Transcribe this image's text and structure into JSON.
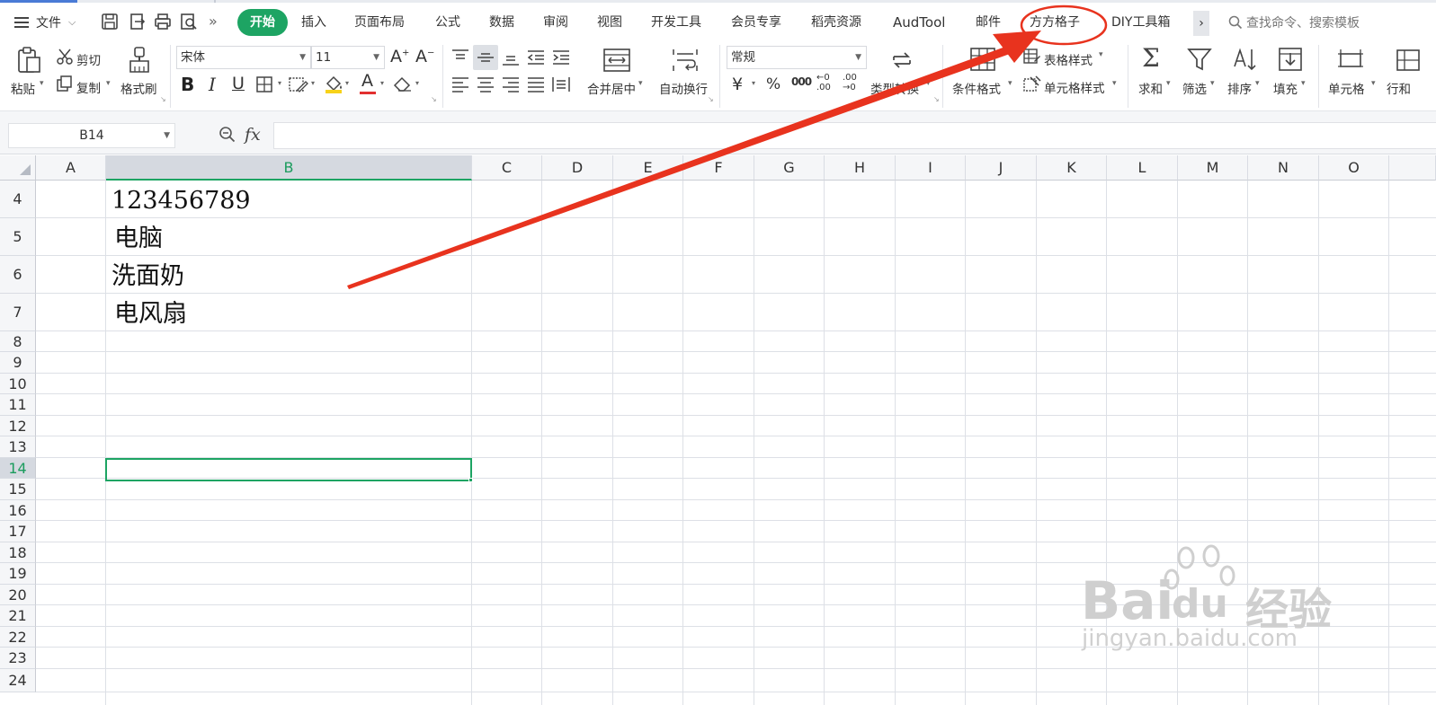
{
  "menu": {
    "file_label": "文件",
    "more_label": "»",
    "scroll_right": "›"
  },
  "tabs": [
    {
      "label": "开始",
      "active": true
    },
    {
      "label": "插入"
    },
    {
      "label": "页面布局"
    },
    {
      "label": "公式"
    },
    {
      "label": "数据"
    },
    {
      "label": "审阅"
    },
    {
      "label": "视图"
    },
    {
      "label": "开发工具"
    },
    {
      "label": "会员专享"
    },
    {
      "label": "稻壳资源"
    },
    {
      "label": "AudTool"
    },
    {
      "label": "邮件"
    },
    {
      "label": "方方格子"
    },
    {
      "label": "DIY工具箱"
    }
  ],
  "search": {
    "placeholder": "查找命令、搜索模板"
  },
  "ribbon": {
    "paste": "粘贴",
    "cut": "剪切",
    "copy": "复制",
    "format_painter": "格式刷",
    "font_name": "宋体",
    "font_size": "11",
    "merge_center": "合并居中",
    "wrap_text": "自动换行",
    "number_format": "常规",
    "currency_symbol": "¥",
    "percent_symbol": "%",
    "thousands": "000",
    "dec_increase": ".00",
    "dec_decrease": ".00",
    "type_convert": "类型转换",
    "conditional_format": "条件格式",
    "table_style": "表格样式",
    "cell_style": "单元格样式",
    "sum": "求和",
    "filter": "筛选",
    "sort": "排序",
    "fill": "填充",
    "cell": "单元格",
    "row_col": "行和"
  },
  "formula_bar": {
    "name_box": "B14",
    "fx": "fx",
    "value": ""
  },
  "sheet": {
    "columns": [
      "A",
      "B",
      "C",
      "D",
      "E",
      "F",
      "G",
      "H",
      "I",
      "J",
      "K",
      "L",
      "M",
      "N",
      "O"
    ],
    "selected_column": "B",
    "rows": [
      "4",
      "5",
      "6",
      "7",
      "8",
      "9",
      "10",
      "11",
      "12",
      "13",
      "14",
      "15",
      "16",
      "17",
      "18",
      "19",
      "20",
      "21",
      "22",
      "23",
      "24"
    ],
    "selected_row": "14",
    "cells": [
      {
        "ref": "B4",
        "value": "123456789"
      },
      {
        "ref": "B5",
        "value": "电脑"
      },
      {
        "ref": "B6",
        "value": "洗面奶"
      },
      {
        "ref": "B7",
        "value": "电风扇"
      }
    ]
  },
  "watermark": {
    "brand": "Bai",
    "paw": "du",
    "jy": "经验",
    "url": "jingyan.baidu.com"
  },
  "annotation": {
    "color": "#e8331e",
    "target_tab": "方方格子"
  }
}
